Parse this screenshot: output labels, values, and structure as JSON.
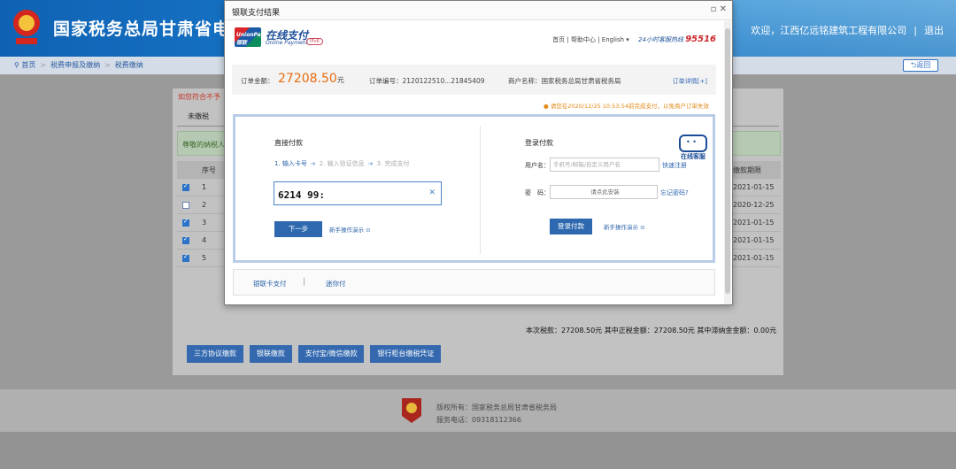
{
  "site": {
    "title": "国家税务总局甘肃省电子税",
    "welcome": "欢迎，江西亿远铭建筑工程有限公司",
    "logout": "退出"
  },
  "breadcrumb": [
    "首页",
    "税费申报及缴纳",
    "税费缴纳"
  ],
  "back_label": "返回",
  "main": {
    "warning": "如您符合不予",
    "tab_unpaid": "未缴税",
    "notice": "尊敬的纳税人",
    "table": {
      "col_no": "序号",
      "col_due": "缴款期限",
      "rows": [
        {
          "no": "1",
          "checked": true,
          "due": "2021-01-15"
        },
        {
          "no": "2",
          "checked": false,
          "due": "2020-12-25"
        },
        {
          "no": "3",
          "checked": true,
          "due": "2021-01-15"
        },
        {
          "no": "4",
          "checked": true,
          "due": "2021-01-15"
        },
        {
          "no": "5",
          "checked": true,
          "due": "2021-01-15"
        }
      ]
    },
    "summary": "本次税款：27208.50元    其中正税金额：27208.50元    其中滞纳金金额：0.00元",
    "actions": [
      "三方协议缴款",
      "银联缴款",
      "支付宝/微信缴款",
      "银行柜台缴税凭证"
    ]
  },
  "footer": {
    "copyright": "版权所有：国家税务总局甘肃省税务局",
    "phone": "服务电话：09318112366"
  },
  "modal": {
    "title": "银联支付结果",
    "controls": "▫ ✕",
    "brand_cn": "在线支付",
    "brand_en": "Online Payment",
    "ipv6": "IPv6",
    "logo_text": "UnionPay 银联",
    "nav": "首页 | 帮助中心 | English ▾",
    "hotline_label": "24小时客服热线",
    "hotline": "95516",
    "order_amount_label": "订单金额：",
    "order_amount": "27208.50",
    "order_amount_unit": "元",
    "order_no": "订单编号：2120122510...21845409",
    "merchant": "商户名称：国家税务总局甘肃省税务局",
    "order_detail": "订单详情[+]",
    "deadline": "请您在2020/12/25 10:53:54前完成支付，以免商户订单失效",
    "direct": {
      "title": "直接付款",
      "step1": "1. 输入卡号",
      "step2": "2. 输入验证信息",
      "step3": "3. 完成支付",
      "card_value": "6214 99:",
      "next": "下一步",
      "guide": "新手操作演示"
    },
    "login": {
      "title": "登录付款",
      "user_label": "用户名：",
      "user_placeholder": "手机号/邮箱/自定义用户名",
      "register": "快速注册",
      "pwd_label": "密　码：",
      "pwd_placeholder": "请点此安装",
      "forgot": "忘记密码?",
      "submit": "登录付款",
      "guide": "新手操作演示"
    },
    "service": "在线客服",
    "tabs": [
      "银联卡支付",
      "迷你付"
    ]
  }
}
